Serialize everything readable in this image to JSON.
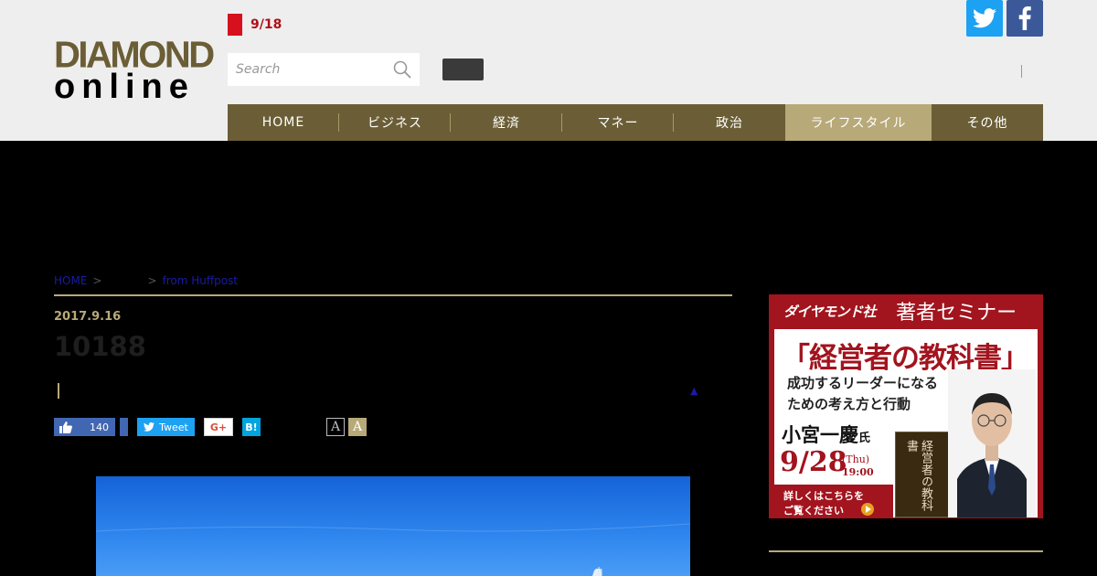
{
  "header": {
    "logo": {
      "line1": "DIAMOND",
      "line2": "online"
    },
    "date": "9/18",
    "search": {
      "placeholder": "Search"
    },
    "social": [
      "twitter-icon",
      "facebook-icon"
    ]
  },
  "nav": {
    "items": [
      {
        "label": "HOME",
        "active": false
      },
      {
        "label": "ビジネス",
        "active": false
      },
      {
        "label": "経済",
        "active": false
      },
      {
        "label": "マネー",
        "active": false
      },
      {
        "label": "政治",
        "active": false
      },
      {
        "label": "ライフスタイル",
        "active": true
      },
      {
        "label": "その他",
        "active": false
      }
    ]
  },
  "breadcrumb": {
    "home": "HOME",
    "sep": ">",
    "section": "from Huffpost"
  },
  "article": {
    "date": "2017.9.16",
    "title": "10188",
    "like_count": "140",
    "tweet_label": "Tweet",
    "gplus_label": "G+",
    "hatena_label": "B!",
    "font_small": "A",
    "font_large": "A",
    "up_arrow": "▲"
  },
  "ad": {
    "brand": "ダイヤモンド社",
    "seminar": "著者セミナー",
    "book_title": "「経営者の教科書」",
    "subtitle1": "成功するリーダーになる",
    "subtitle2": "ための考え方と行動",
    "speaker": "小宮一慶",
    "honorific": "氏",
    "date": "9/28",
    "day": "(Thu)",
    "time": "19:00",
    "cta1": "詳しくはこちらを",
    "cta2": "ご覧ください",
    "book_cover": "経営者の教科書"
  },
  "colors": {
    "brand_gold": "#6b5e36",
    "nav_active": "#b8a978",
    "accent_red": "#d6101c",
    "twitter": "#1da1f2",
    "facebook": "#3b5998"
  }
}
